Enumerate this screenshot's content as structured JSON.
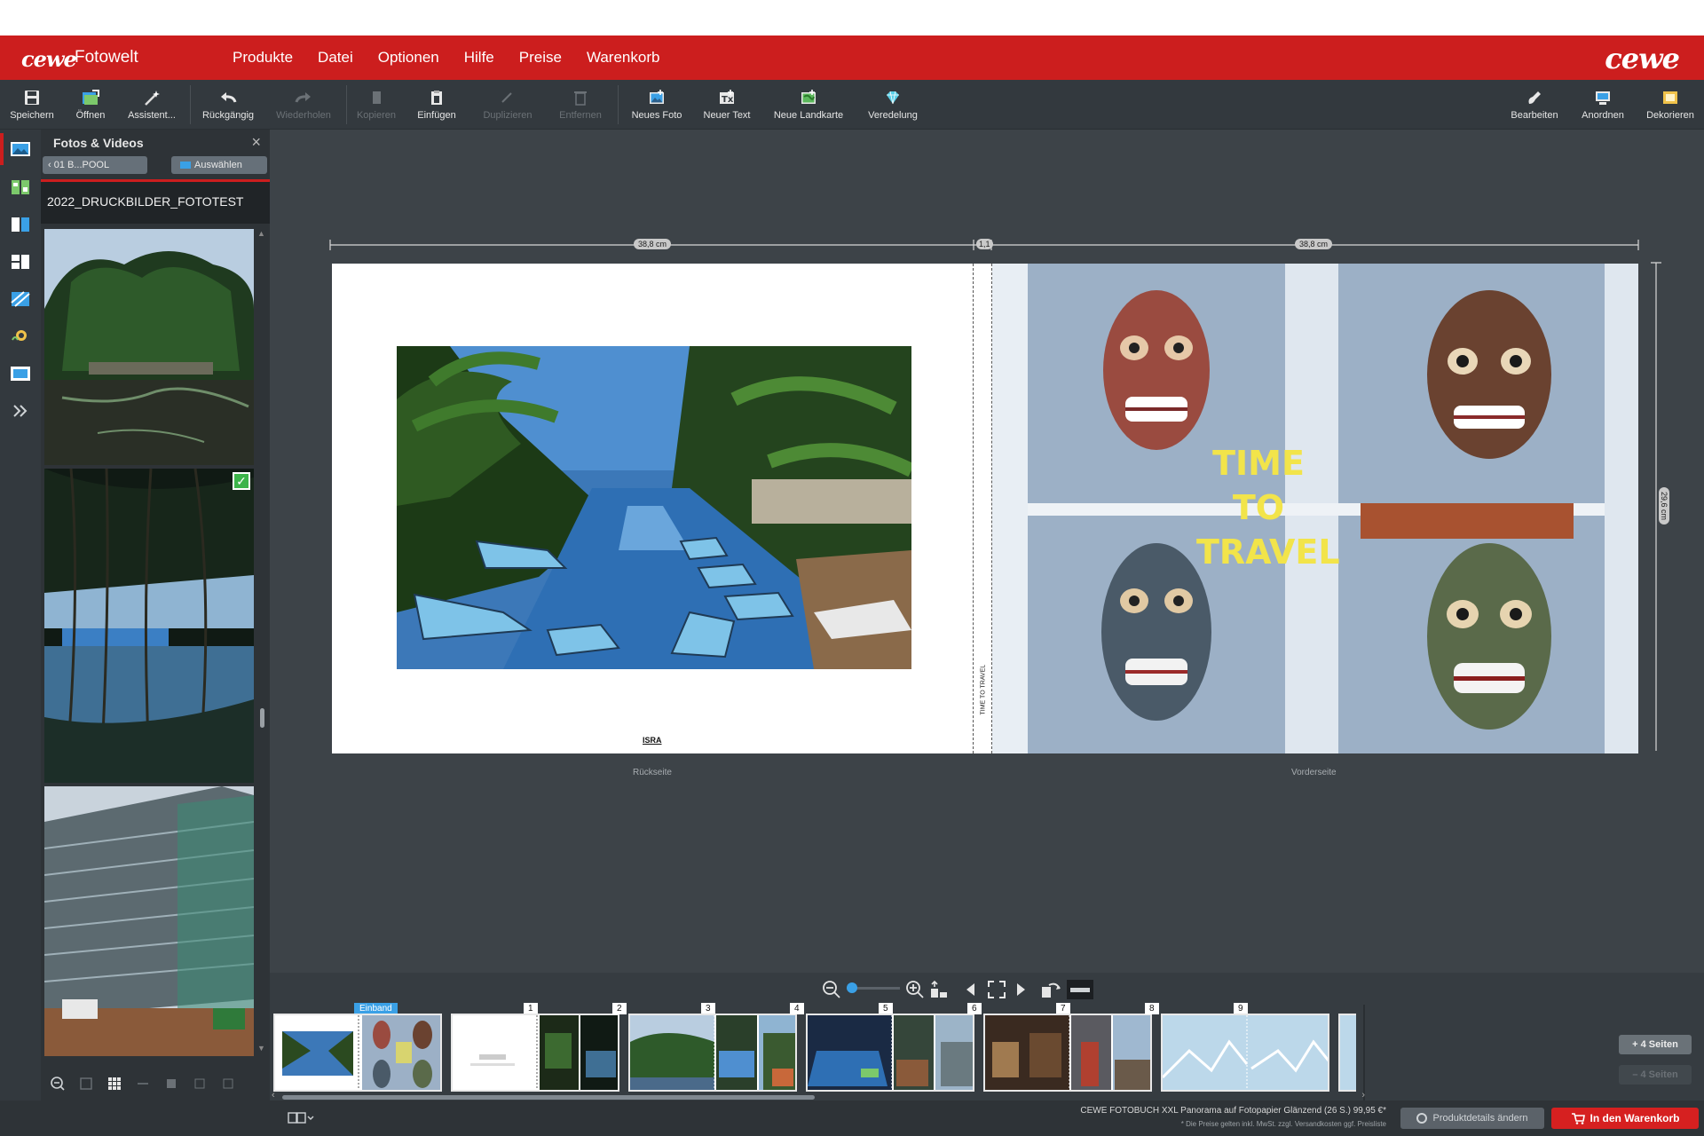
{
  "app": {
    "brand_logo": "cewe",
    "brand_name": "Fotowelt",
    "brand_logo_right": "cewe"
  },
  "menu": [
    "Produkte",
    "Datei",
    "Optionen",
    "Hilfe",
    "Preise",
    "Warenkorb"
  ],
  "toolbar": {
    "save": "Speichern",
    "open": "Öffnen",
    "assistant": "Assistent...",
    "undo": "Rückgängig",
    "redo": "Wiederholen",
    "cut": "Kopieren",
    "paste": "Einfügen",
    "duplicate": "Duplizieren",
    "delete": "Entfernen",
    "new_photo": "Neues Foto",
    "new_text": "Neuer Text",
    "new_map": "Neue Landkarte",
    "finishing": "Veredelung",
    "edit": "Bearbeiten",
    "arrange": "Anordnen",
    "decorate": "Dekorieren"
  },
  "panel": {
    "title": "Fotos & Videos",
    "back_label": "01 B...POOL",
    "select_label": "Auswählen",
    "folder_name": "2022_DRUCKBILDER_FOTOTEST"
  },
  "canvas": {
    "dim_left": "38,8 cm",
    "dim_spine": "1,1",
    "dim_right": "38,8 cm",
    "dim_height": "29,6 cm",
    "cover_title": "TIME TO TRAVEL",
    "cover_title_lines": [
      "TIME",
      "TO",
      "TRAVEL"
    ],
    "spine_text": "TIME TO TRAVEL",
    "back_caption": "ISRA",
    "back_label": "Rückseite",
    "front_label": "Vorderseite"
  },
  "filmstrip": {
    "einband_label": "Einband",
    "page_numbers": [
      "1",
      "2",
      "3",
      "4",
      "5",
      "6",
      "7",
      "8",
      "9"
    ],
    "add_pages": "+ 4 Seiten",
    "remove_pages": "– 4 Seiten"
  },
  "bottom": {
    "order_summary": "CEWE FOTOBUCH XXL Panorama auf Fotopapier Glänzend (26 S.) 99,95 €*",
    "price_note": "* Die Preise gelten inkl. MwSt. zzgl. Versandkosten ggf. Preisliste",
    "change_product": "Produktdetails ändern",
    "cart": "In den Warenkorb"
  },
  "colors": {
    "brand_red": "#cc1e1e",
    "accent_blue": "#3aa0e6",
    "cover_text_yellow": "#f2e44a",
    "check_green": "#3cb44a"
  }
}
